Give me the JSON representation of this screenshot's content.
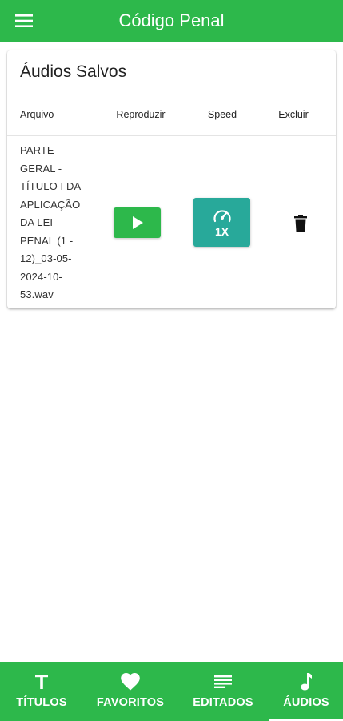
{
  "appbar": {
    "title": "Código Penal",
    "menu_icon": "menu-icon"
  },
  "card": {
    "title": "Áudios Salvos",
    "columns": {
      "file": "Arquivo",
      "play": "Reproduzir",
      "speed": "Speed",
      "delete": "Excluir"
    },
    "rows": [
      {
        "file": "PARTE GERAL - TÍTULO I DA APLICAÇÃO DA LEI PENAL (1 - 12)_03-05-2024-10-53.wav",
        "play_icon": "play-icon",
        "speed_icon": "speedometer-icon",
        "speed": "1X",
        "delete_icon": "trash-icon"
      }
    ]
  },
  "bottom_nav": {
    "items": [
      {
        "label": "TÍTULOS",
        "icon": "text-t-icon"
      },
      {
        "label": "FAVORITOS",
        "icon": "heart-icon"
      },
      {
        "label": "EDITADOS",
        "icon": "notes-lines-icon"
      },
      {
        "label": "ÁUDIOS",
        "icon": "music-note-icon",
        "active": true
      }
    ]
  },
  "colors": {
    "primary": "#2db84b",
    "speed_button": "#28a99a",
    "text": "#222222"
  }
}
